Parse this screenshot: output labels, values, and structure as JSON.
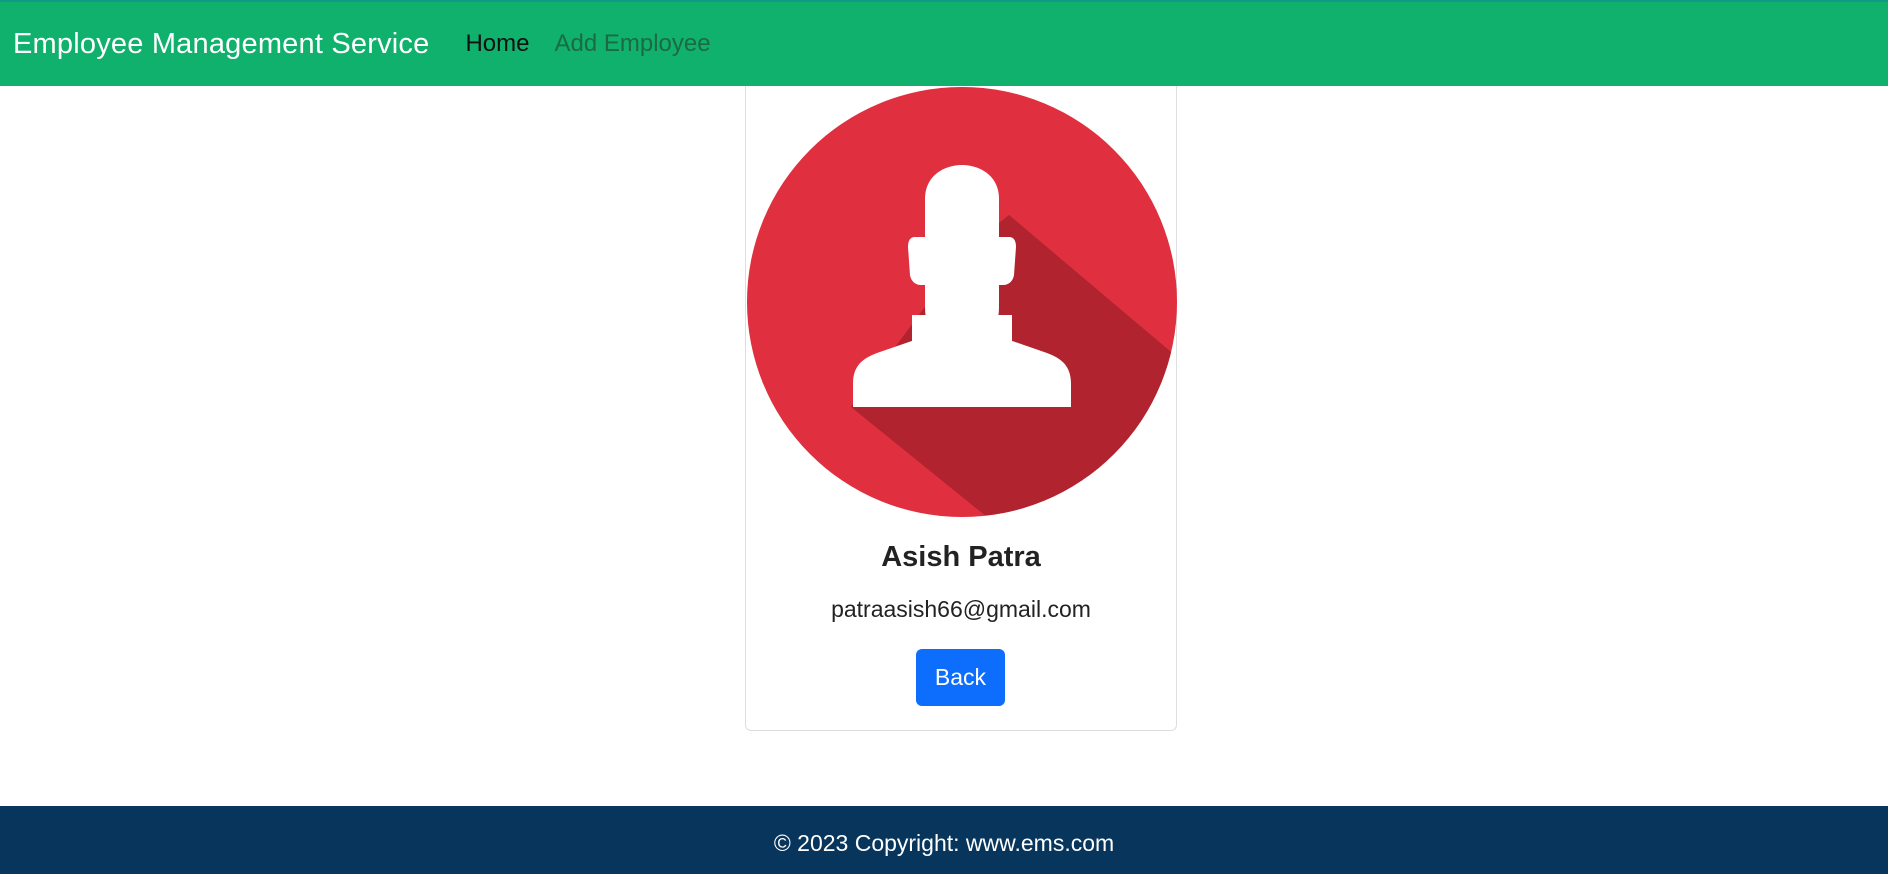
{
  "navbar": {
    "brand": "Employee Management Service",
    "links": [
      {
        "label": "Home",
        "state": "active"
      },
      {
        "label": "Add Employee",
        "state": "muted"
      }
    ],
    "background_color": "#10b06d"
  },
  "profile": {
    "avatar_icon": "user-avatar-icon",
    "avatar_color": "#e02f3e",
    "name": "Asish Patra",
    "email": "patraasish66@gmail.com",
    "back_label": "Back",
    "button_color": "#0d6efd"
  },
  "footer": {
    "text": "© 2023 Copyright: www.ems.com",
    "background_color": "#08355c"
  }
}
